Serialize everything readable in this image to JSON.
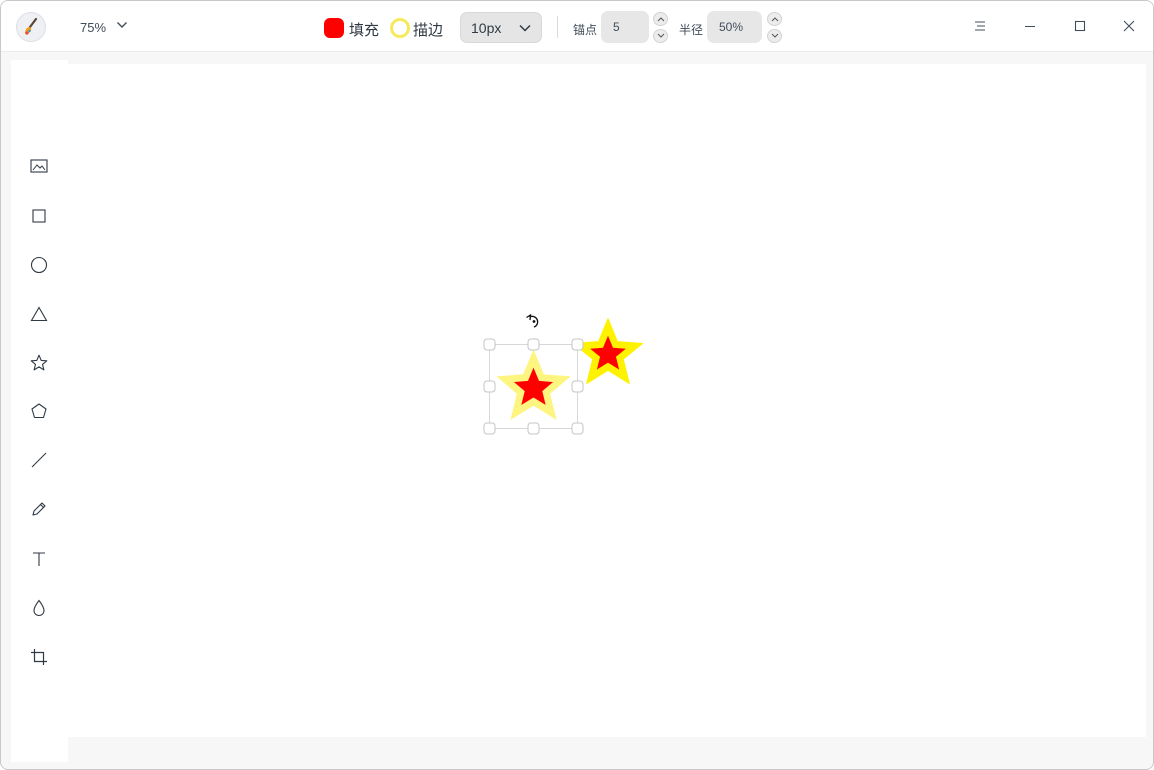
{
  "app": {
    "icon": "brush-palette-icon",
    "zoom": "75%"
  },
  "properties": {
    "fill_label": "填充",
    "fill_color": "#ff0000",
    "stroke_label": "描边",
    "stroke_color": "#f5e95c",
    "stroke_width": "10px",
    "anchor_label": "锚点",
    "anchor_value": "5",
    "radius_label": "半径",
    "radius_value": "50%"
  },
  "window_controls": [
    "menu-icon",
    "minimize-icon",
    "maximize-icon",
    "close-icon"
  ],
  "tools": [
    "image-tool-icon",
    "rectangle-tool-icon",
    "ellipse-tool-icon",
    "triangle-tool-icon",
    "star-tool-icon",
    "polygon-tool-icon",
    "line-tool-icon",
    "pen-tool-icon",
    "text-tool-icon",
    "blur-tool-icon",
    "crop-tool-icon"
  ],
  "canvas": {
    "shapes": [
      {
        "type": "star",
        "points": 5,
        "fill": "#ff0000",
        "stroke": "#fdf57f",
        "selected": true
      },
      {
        "type": "star",
        "points": 5,
        "fill": "#ff0000",
        "stroke": "#fef200",
        "selected": false
      }
    ]
  }
}
